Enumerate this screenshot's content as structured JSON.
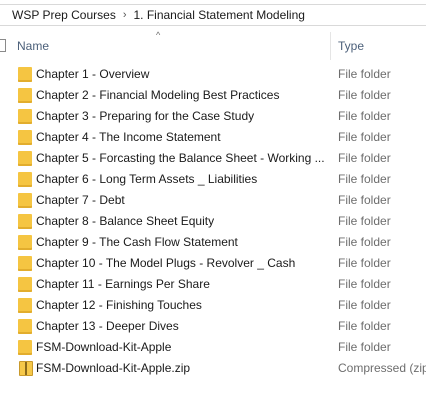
{
  "breadcrumb": {
    "items": [
      "WSP Prep Courses",
      "1. Financial Statement Modeling"
    ],
    "separator": "›"
  },
  "header": {
    "name_label": "Name",
    "type_label": "Type",
    "sort_indicator": "^"
  },
  "files": [
    {
      "name": "Chapter 1 - Overview",
      "type": "File folder",
      "icon": "folder-icon"
    },
    {
      "name": "Chapter 2 - Financial Modeling Best Practices",
      "type": "File folder",
      "icon": "folder-icon"
    },
    {
      "name": "Chapter 3 - Preparing for the Case Study",
      "type": "File folder",
      "icon": "folder-icon"
    },
    {
      "name": "Chapter 4 - The Income Statement",
      "type": "File folder",
      "icon": "folder-icon"
    },
    {
      "name": "Chapter 5 - Forcasting the Balance Sheet - Working ...",
      "type": "File folder",
      "icon": "folder-icon"
    },
    {
      "name": "Chapter 6 - Long Term Assets _ Liabilities",
      "type": "File folder",
      "icon": "folder-icon"
    },
    {
      "name": "Chapter 7 - Debt",
      "type": "File folder",
      "icon": "folder-icon"
    },
    {
      "name": "Chapter 8 - Balance Sheet Equity",
      "type": "File folder",
      "icon": "folder-icon"
    },
    {
      "name": "Chapter 9 - The Cash Flow Statement",
      "type": "File folder",
      "icon": "folder-icon"
    },
    {
      "name": "Chapter 10 - The Model Plugs - Revolver _ Cash",
      "type": "File folder",
      "icon": "folder-icon"
    },
    {
      "name": "Chapter 11 - Earnings Per Share",
      "type": "File folder",
      "icon": "folder-icon"
    },
    {
      "name": "Chapter 12 - Finishing Touches",
      "type": "File folder",
      "icon": "folder-icon"
    },
    {
      "name": "Chapter 13 - Deeper Dives",
      "type": "File folder",
      "icon": "folder-icon"
    },
    {
      "name": "FSM-Download-Kit-Apple",
      "type": "File folder",
      "icon": "folder-icon"
    },
    {
      "name": "FSM-Download-Kit-Apple.zip",
      "type": "Compressed (zip",
      "icon": "zip-icon"
    }
  ],
  "colors": {
    "folder": "#f5c542",
    "header_text": "#4c607a",
    "type_text": "#6d6d6d"
  }
}
